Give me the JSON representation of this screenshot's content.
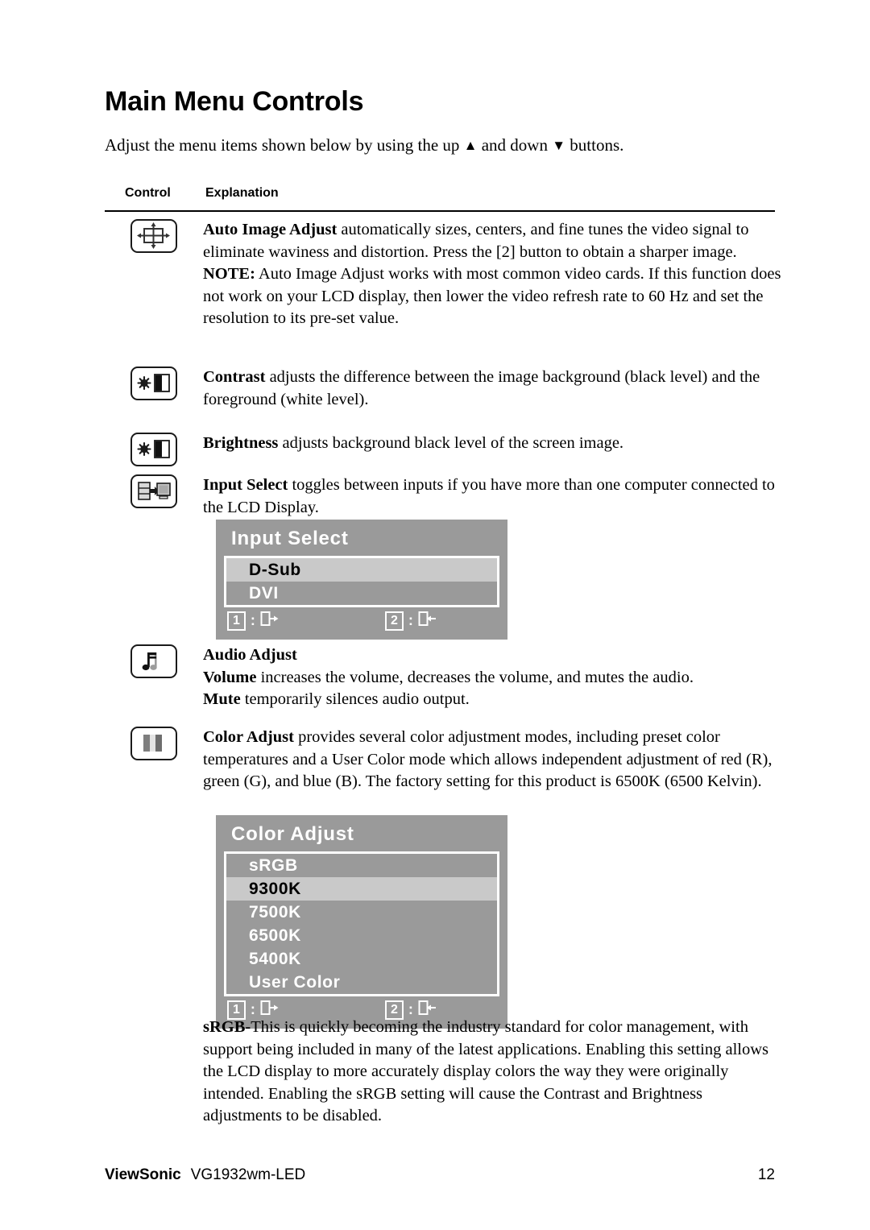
{
  "document": {
    "title": "Main Menu Controls",
    "intro_before": "Adjust the menu items shown below by using the up ",
    "intro_up_glyph": "▲",
    "intro_middle": " and down ",
    "intro_down_glyph": "▼",
    "intro_after": " buttons."
  },
  "table": {
    "headers": {
      "control": "Control",
      "explanation": "Explanation"
    }
  },
  "rows": {
    "auto_image_adjust": {
      "icon": "auto-image-adjust-icon",
      "term": "Auto Image Adjust",
      "body": " automatically sizes, centers, and fine tunes the video signal to eliminate waviness and distortion. Press the [2] button to obtain a sharper image.",
      "note_label": "NOTE:",
      "note_body": " Auto Image Adjust works with most common video cards. If this function does not work on your LCD display, then lower the video refresh rate to 60 Hz and set the resolution to its pre-set value."
    },
    "contrast": {
      "icon": "contrast-icon",
      "term": "Contrast",
      "body": " adjusts the difference between the image background  (black level) and the foreground (white level)."
    },
    "brightness": {
      "icon": "brightness-icon",
      "term": "Brightness",
      "body": " adjusts background black level of the screen image."
    },
    "input_select": {
      "icon": "input-select-icon",
      "term": "Input Select",
      "body": " toggles between inputs if you have more than one computer connected to the LCD Display."
    },
    "audio_adjust": {
      "icon": "audio-adjust-icon",
      "heading": "Audio Adjust",
      "volume_term": "Volume",
      "volume_body": " increases the volume, decreases the volume, and mutes the audio.",
      "mute_term": "Mute",
      "mute_body": " temporarily silences audio output."
    },
    "color_adjust": {
      "icon": "color-adjust-icon",
      "term": "Color Adjust",
      "body": " provides several color adjustment modes, including preset color temperatures and a User Color mode which allows independent adjustment of red (R), green (G), and blue (B). The factory setting for this product is 6500K (6500 Kelvin)."
    },
    "srgb": {
      "term": "sRGB-",
      "body": "This is quickly becoming the industry standard for color management, with support being included in many of the latest applications. Enabling this setting allows the LCD display to more accurately display colors the way they were originally intended. Enabling the sRGB setting will cause the Contrast and Brightness adjustments to be disabled."
    }
  },
  "osd_input_select": {
    "title": "Input Select",
    "items": [
      {
        "label": "D-Sub",
        "selected": true
      },
      {
        "label": "DVI",
        "selected": false
      }
    ],
    "footer": {
      "key1": "1",
      "key1_sep": ":",
      "key1_icon": "exit-icon",
      "key2": "2",
      "key2_sep": ":",
      "key2_icon": "enter-icon"
    },
    "colors": {
      "background": "#9a9a9a",
      "selected_row": "#c9c9c9",
      "border": "#ffffff"
    }
  },
  "osd_color_adjust": {
    "title": "Color Adjust",
    "items": [
      {
        "label": "sRGB",
        "selected": false
      },
      {
        "label": "9300K",
        "selected": true
      },
      {
        "label": "7500K",
        "selected": false
      },
      {
        "label": "6500K",
        "selected": false
      },
      {
        "label": "5400K",
        "selected": false
      },
      {
        "label": "User Color",
        "selected": false
      }
    ],
    "footer": {
      "key1": "1",
      "key1_sep": ":",
      "key1_icon": "exit-icon",
      "key2": "2",
      "key2_sep": ":",
      "key2_icon": "enter-icon"
    },
    "colors": {
      "background": "#9a9a9a",
      "selected_row": "#c9c9c9",
      "border": "#ffffff"
    }
  },
  "footer": {
    "brand": "ViewSonic",
    "model": "VG1932wm-LED",
    "page_number": "12"
  }
}
